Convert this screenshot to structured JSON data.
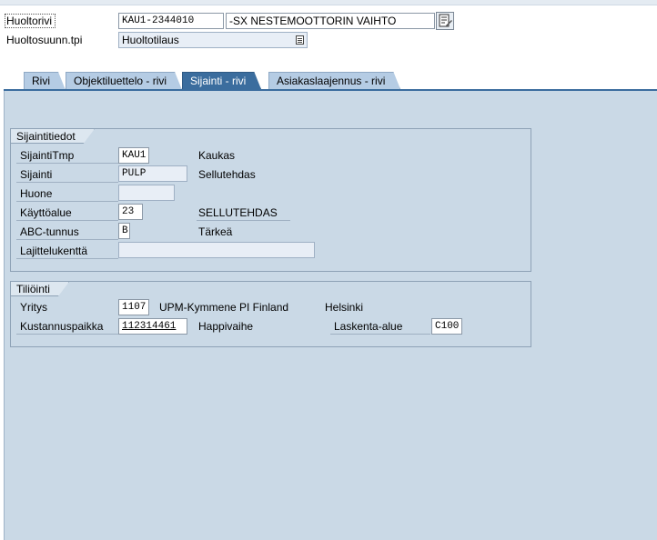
{
  "header": {
    "order_item_label": "Huoltorivi",
    "order_item_value": "KAU1-2344010",
    "order_item_desc": "-SX NESTEMOOTTORIN VAIHTO",
    "order_type_label": "Huoltosuunn.tpi",
    "order_type_value": "Huoltotilaus"
  },
  "tabs": [
    {
      "label": "Rivi",
      "active": false
    },
    {
      "label": "Objektiluettelo - rivi",
      "active": false
    },
    {
      "label": "Sijainti - rivi",
      "active": true
    },
    {
      "label": "Asiakaslaajennus - rivi",
      "active": false
    }
  ],
  "location_group": {
    "title": "Sijaintitiedot",
    "rows": [
      {
        "label": "SijaintiTmp",
        "value": "KAU1",
        "text": "Kaukas"
      },
      {
        "label": "Sijainti",
        "value": "PULP",
        "text": "Sellutehdas"
      },
      {
        "label": "Huone",
        "value": "",
        "text": ""
      },
      {
        "label": "Käyttöalue",
        "value": "23",
        "text": "SELLUTEHDAS"
      },
      {
        "label": "ABC-tunnus",
        "value": "B",
        "text": "Tärkeä"
      },
      {
        "label": "Lajittelukenttä",
        "value": "",
        "text": ""
      }
    ]
  },
  "account_group": {
    "title": "Tiliöinti",
    "company_label": "Yritys",
    "company_value": "1107",
    "company_name": "UPM-Kymmene PI Finland",
    "company_city": "Helsinki",
    "cost_center_label": "Kustannuspaikka",
    "cost_center_value": "112314461",
    "cost_center_text": "Happivaihe",
    "controlling_area_label": "Laskenta-alue",
    "controlling_area_value": "C100"
  }
}
